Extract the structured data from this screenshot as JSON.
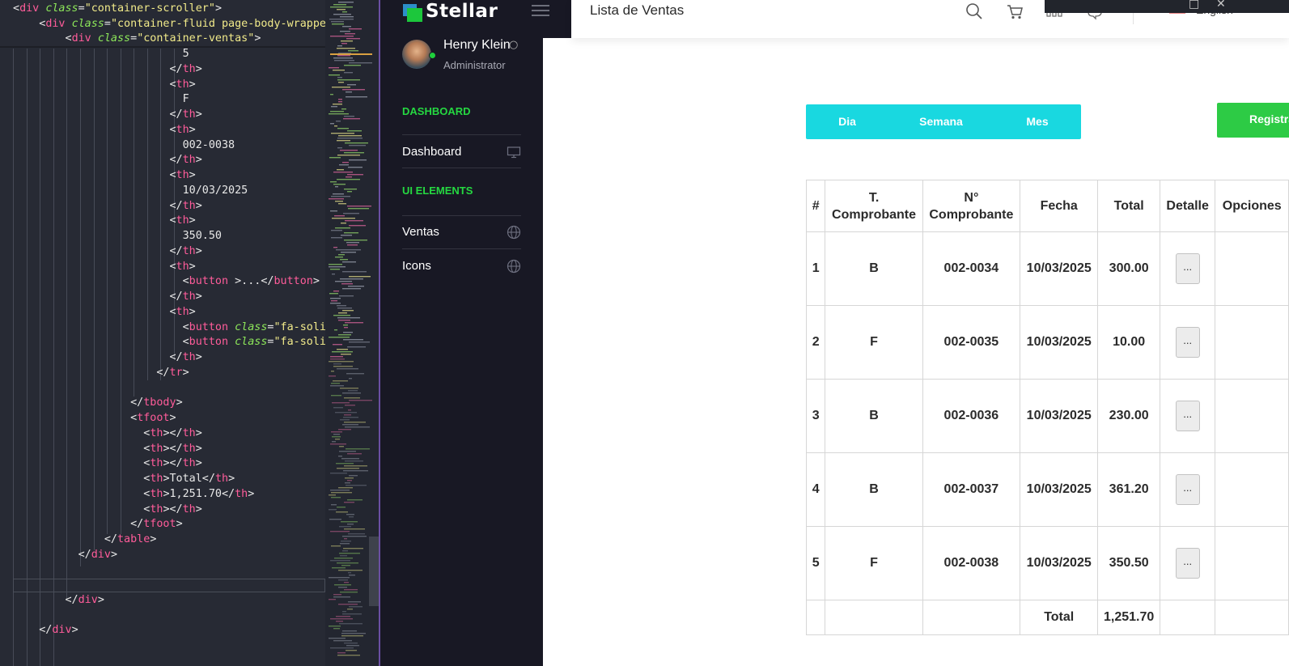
{
  "editor": {
    "lines": [
      [
        [
          "t",
          "<"
        ],
        [
          "g",
          "div "
        ],
        [
          "a",
          "class"
        ],
        [
          "t",
          "="
        ],
        [
          "s",
          "\"container-scroller\""
        ],
        [
          "t",
          ">"
        ]
      ],
      [
        [
          "t",
          "    <"
        ],
        [
          "g",
          "div "
        ],
        [
          "a",
          "class"
        ],
        [
          "t",
          "="
        ],
        [
          "s",
          "\"container-fluid page-body-wrapper\""
        ],
        [
          "t",
          ">"
        ]
      ],
      [
        [
          "t",
          "        <"
        ],
        [
          "g",
          "div "
        ],
        [
          "a",
          "class"
        ],
        [
          "t",
          "="
        ],
        [
          "s",
          "\"container-ventas\""
        ],
        [
          "t",
          ">"
        ]
      ],
      [
        [
          "t",
          "                          5"
        ]
      ],
      [
        [
          "t",
          "                        </"
        ],
        [
          "g",
          "th"
        ],
        [
          "t",
          ">"
        ]
      ],
      [
        [
          "t",
          "                        <"
        ],
        [
          "g",
          "th"
        ],
        [
          "t",
          ">"
        ]
      ],
      [
        [
          "t",
          "                          F"
        ]
      ],
      [
        [
          "t",
          "                        </"
        ],
        [
          "g",
          "th"
        ],
        [
          "t",
          ">"
        ]
      ],
      [
        [
          "t",
          "                        <"
        ],
        [
          "g",
          "th"
        ],
        [
          "t",
          ">"
        ]
      ],
      [
        [
          "t",
          "                          002-0038"
        ]
      ],
      [
        [
          "t",
          "                        </"
        ],
        [
          "g",
          "th"
        ],
        [
          "t",
          ">"
        ]
      ],
      [
        [
          "t",
          "                        <"
        ],
        [
          "g",
          "th"
        ],
        [
          "t",
          ">"
        ]
      ],
      [
        [
          "t",
          "                          10/03/2025"
        ]
      ],
      [
        [
          "t",
          "                        </"
        ],
        [
          "g",
          "th"
        ],
        [
          "t",
          ">"
        ]
      ],
      [
        [
          "t",
          "                        <"
        ],
        [
          "g",
          "th"
        ],
        [
          "t",
          ">"
        ]
      ],
      [
        [
          "t",
          "                          350.50"
        ]
      ],
      [
        [
          "t",
          "                        </"
        ],
        [
          "g",
          "th"
        ],
        [
          "t",
          ">"
        ]
      ],
      [
        [
          "t",
          "                        <"
        ],
        [
          "g",
          "th"
        ],
        [
          "t",
          ">"
        ]
      ],
      [
        [
          "t",
          "                          <"
        ],
        [
          "g",
          "button "
        ],
        [
          "t",
          ">...</"
        ],
        [
          "g",
          "button"
        ],
        [
          "t",
          ">"
        ]
      ],
      [
        [
          "t",
          "                        </"
        ],
        [
          "g",
          "th"
        ],
        [
          "t",
          ">"
        ]
      ],
      [
        [
          "t",
          "                        <"
        ],
        [
          "g",
          "th"
        ],
        [
          "t",
          ">"
        ]
      ],
      [
        [
          "t",
          "                          <"
        ],
        [
          "g",
          "button "
        ],
        [
          "a",
          "class"
        ],
        [
          "t",
          "="
        ],
        [
          "s",
          "\"fa-solid\""
        ],
        [
          "t",
          ">"
        ]
      ],
      [
        [
          "t",
          "                          <"
        ],
        [
          "g",
          "button "
        ],
        [
          "a",
          "class"
        ],
        [
          "t",
          "="
        ],
        [
          "s",
          "\"fa-solid\""
        ],
        [
          "t",
          ">"
        ]
      ],
      [
        [
          "t",
          "                        </"
        ],
        [
          "g",
          "th"
        ],
        [
          "t",
          ">"
        ]
      ],
      [
        [
          "t",
          "                      </"
        ],
        [
          "g",
          "tr"
        ],
        [
          "t",
          ">"
        ]
      ],
      [
        [
          "t",
          ""
        ]
      ],
      [
        [
          "t",
          "                  </"
        ],
        [
          "g",
          "tbody"
        ],
        [
          "t",
          ">"
        ]
      ],
      [
        [
          "t",
          "                  <"
        ],
        [
          "g",
          "tfoot"
        ],
        [
          "t",
          ">"
        ]
      ],
      [
        [
          "t",
          "                    <"
        ],
        [
          "g",
          "th"
        ],
        [
          "t",
          "></"
        ],
        [
          "g",
          "th"
        ],
        [
          "t",
          ">"
        ]
      ],
      [
        [
          "t",
          "                    <"
        ],
        [
          "g",
          "th"
        ],
        [
          "t",
          "></"
        ],
        [
          "g",
          "th"
        ],
        [
          "t",
          ">"
        ]
      ],
      [
        [
          "t",
          "                    <"
        ],
        [
          "g",
          "th"
        ],
        [
          "t",
          "></"
        ],
        [
          "g",
          "th"
        ],
        [
          "t",
          ">"
        ]
      ],
      [
        [
          "t",
          "                    <"
        ],
        [
          "g",
          "th"
        ],
        [
          "t",
          ">Total</"
        ],
        [
          "g",
          "th"
        ],
        [
          "t",
          ">"
        ]
      ],
      [
        [
          "t",
          "                    <"
        ],
        [
          "g",
          "th"
        ],
        [
          "t",
          ">1,251.70</"
        ],
        [
          "g",
          "th"
        ],
        [
          "t",
          ">"
        ]
      ],
      [
        [
          "t",
          "                    <"
        ],
        [
          "g",
          "th"
        ],
        [
          "t",
          "></"
        ],
        [
          "g",
          "th"
        ],
        [
          "t",
          ">"
        ]
      ],
      [
        [
          "t",
          "                  </"
        ],
        [
          "g",
          "tfoot"
        ],
        [
          "t",
          ">"
        ]
      ],
      [
        [
          "t",
          "              </"
        ],
        [
          "g",
          "table"
        ],
        [
          "t",
          ">"
        ]
      ],
      [
        [
          "t",
          "          </"
        ],
        [
          "g",
          "div"
        ],
        [
          "t",
          ">"
        ]
      ],
      [
        [
          "t",
          ""
        ]
      ],
      [
        [
          "t",
          ""
        ]
      ],
      [
        [
          "t",
          "        </"
        ],
        [
          "g",
          "div"
        ],
        [
          "t",
          ">"
        ]
      ],
      [
        [
          "t",
          ""
        ]
      ],
      [
        [
          "t",
          "    </"
        ],
        [
          "g",
          "div"
        ],
        [
          "t",
          ">"
        ]
      ]
    ]
  },
  "sidebar": {
    "brand": "Stellar",
    "user": {
      "name": "Henry Klein",
      "role": "Administrator"
    },
    "sections": [
      {
        "heading": "DASHBOARD",
        "items": [
          {
            "label": "Dashboard",
            "icon": "monitor-icon"
          }
        ]
      },
      {
        "heading": "UI ELEMENTS",
        "items": [
          {
            "label": "Ventas",
            "icon": "globe-icon"
          },
          {
            "label": "Icons",
            "icon": "globe-icon"
          }
        ]
      }
    ]
  },
  "header": {
    "title": "Lista de Ventas",
    "icons": [
      "search-icon",
      "cart-icon",
      "grid-icon",
      "chat-icon"
    ],
    "language": "English"
  },
  "filters": {
    "day": "Dia",
    "week": "Semana",
    "month": "Mes"
  },
  "register_button": "Registrar",
  "table": {
    "headers": [
      "#",
      "T. Comprobante",
      "N° Comprobante",
      "Fecha",
      "Total",
      "Detalle",
      "Opciones"
    ],
    "rows": [
      {
        "n": "1",
        "tipo": "B",
        "numero": "002-0034",
        "fecha": "10/03/2025",
        "total": "300.00",
        "detalle": "..."
      },
      {
        "n": "2",
        "tipo": "F",
        "numero": "002-0035",
        "fecha": "10/03/2025",
        "total": "10.00",
        "detalle": "..."
      },
      {
        "n": "3",
        "tipo": "B",
        "numero": "002-0036",
        "fecha": "10/03/2025",
        "total": "230.00",
        "detalle": "..."
      },
      {
        "n": "4",
        "tipo": "B",
        "numero": "002-0037",
        "fecha": "10/03/2025",
        "total": "361.20",
        "detalle": "..."
      },
      {
        "n": "5",
        "tipo": "F",
        "numero": "002-0038",
        "fecha": "10/03/2025",
        "total": "350.50",
        "detalle": "..."
      }
    ],
    "footer": {
      "label": "Total",
      "value": "1,251.70"
    }
  },
  "colors": {
    "accent_green": "#25d841",
    "filter_cyan": "#19d8e0",
    "register_green": "#2dcb45",
    "sidebar_bg": "#181824"
  }
}
